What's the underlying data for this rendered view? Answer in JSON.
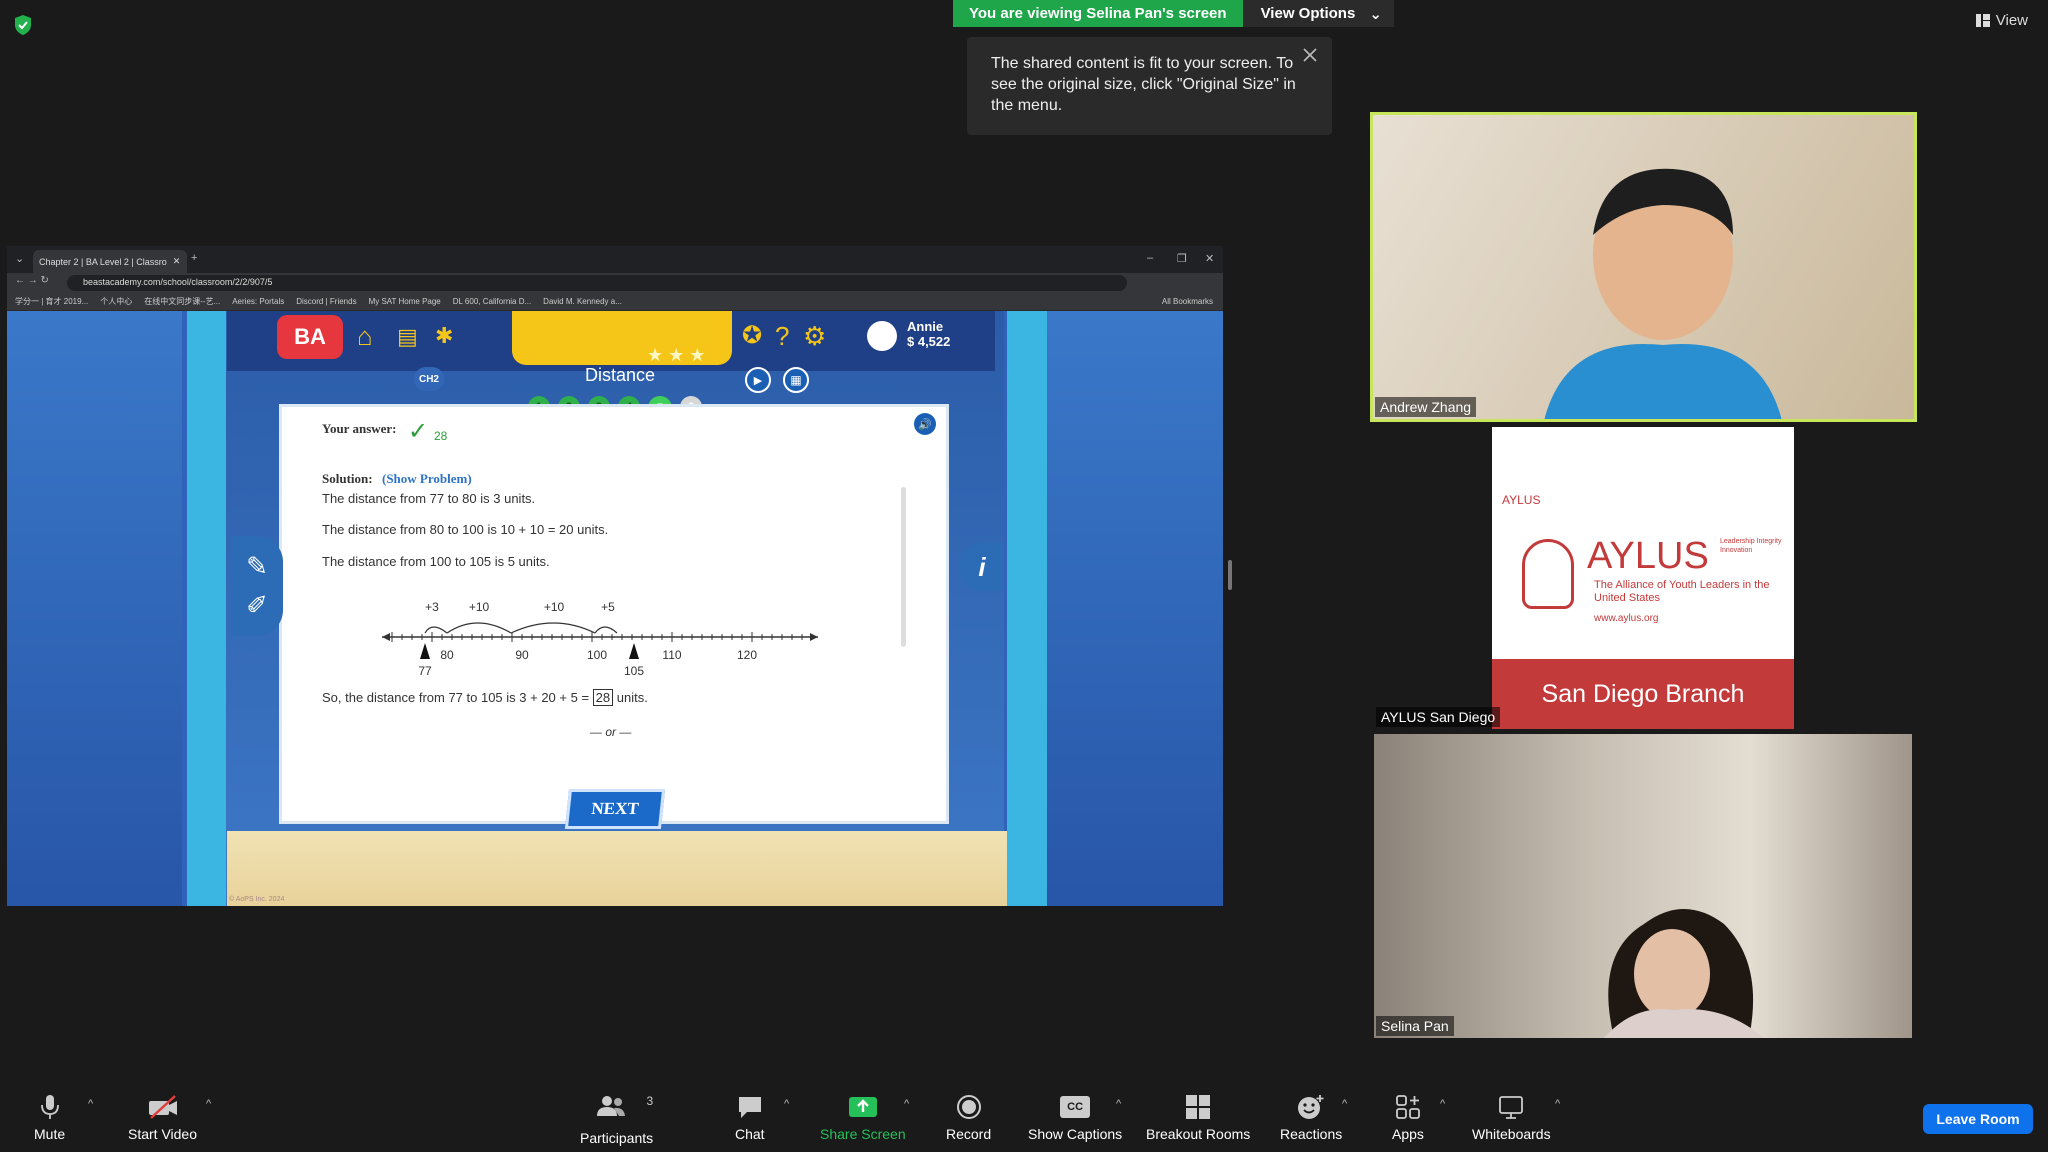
{
  "banner": {
    "viewing": "You are viewing Selina Pan's screen",
    "view_options": "View Options"
  },
  "toast": {
    "text": "The shared content is fit to your screen. To see the original size, click \"Original Size\" in the menu."
  },
  "view_button": "View",
  "browser": {
    "tab_title": "Chapter 2 | BA Level 2 | Classro",
    "url": "beastacademy.com/school/classroom/2/2/907/5",
    "bookmarks": [
      "学分一 | 育才 2019...",
      "个人中心",
      "在线中文同步课--艺...",
      "Aeries: Portals",
      "Discord | Friends",
      "My SAT Home Page",
      "DL 600, California D...",
      "David M. Kennedy a...",
      "All Bookmarks"
    ]
  },
  "game": {
    "logo": "BA",
    "user_name": "Annie",
    "coins": "$ 4,522",
    "chapter": "CH2",
    "title": "Distance",
    "dots": [
      "1",
      "2",
      "3",
      "4",
      "5",
      "6"
    ],
    "answer_label": "Your answer:",
    "answer_value": "28",
    "solution_label": "Solution:",
    "show_problem": "(Show Problem)",
    "lines": [
      "The distance from 77 to 80 is 3 units.",
      "The distance from 80 to 100 is 10 + 10 = 20 units.",
      "The distance from 100 to 105 is 5 units."
    ],
    "jumps": [
      "+3",
      "+10",
      "+10",
      "+5"
    ],
    "ticks": [
      "80",
      "90",
      "100",
      "110",
      "120"
    ],
    "markers": [
      "77",
      "105"
    ],
    "conclusion_pre": "So, the distance from 77 to 105 is 3 + 20 + 5 =",
    "conclusion_box": "28",
    "conclusion_post": "units.",
    "or": "— or —",
    "next": "NEXT",
    "copyright": "© AoPS Inc. 2024"
  },
  "participants": [
    {
      "name": "Andrew Zhang"
    },
    {
      "name": "AYLUS San Diego",
      "logo_org": "AYLUS",
      "logo_name": "AYLUS",
      "logo_sub": "The Alliance of Youth Leaders in the United States",
      "logo_url": "www.aylus.org",
      "logo_tags": "Leadership Integrity Innovation",
      "logo_branch": "San Diego Branch"
    },
    {
      "name": "Selina Pan"
    }
  ],
  "toolbar": {
    "mute": "Mute",
    "start_video": "Start Video",
    "participants": "Participants",
    "participants_count": "3",
    "chat": "Chat",
    "share_screen": "Share Screen",
    "record": "Record",
    "captions": "Show Captions",
    "captions_icon": "CC",
    "breakout": "Breakout Rooms",
    "reactions": "Reactions",
    "apps": "Apps",
    "whiteboards": "Whiteboards",
    "leave": "Leave Room"
  },
  "colors": {
    "share_green": "#1fa64b",
    "leave_blue": "#0e72ed",
    "speaker_border": "#c8e65b"
  }
}
